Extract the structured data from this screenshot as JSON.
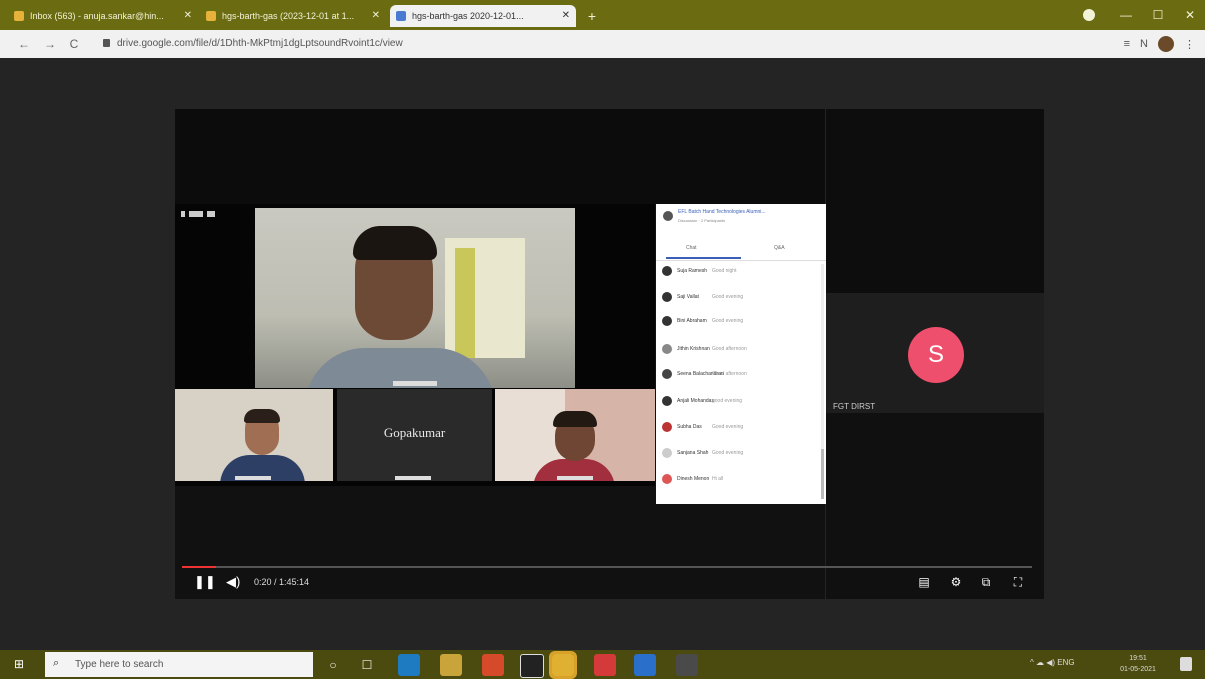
{
  "browser": {
    "tabs": [
      {
        "label": "Inbox (563) - anuja.sankar@hin...",
        "active": false
      },
      {
        "label": "hgs-barth-gas (2023-12-01 at 1...",
        "active": false
      },
      {
        "label": "hgs-barth-gas 2020-12-01...",
        "active": true
      }
    ],
    "new_tab": "+",
    "window_controls": [
      "—",
      "☐",
      "✕"
    ],
    "nav": {
      "back": "←",
      "forward": "→",
      "reload": "C"
    },
    "url": "drive.google.com/file/d/1Dhth-MkPtmj1dgLptsoundRvoint1c/view",
    "toolbar_icons": [
      "≡",
      "N"
    ]
  },
  "player": {
    "time": "0:20 / 1:45:14",
    "play_icon": "❚❚",
    "volume_icon": "◀)",
    "progress": 0.04,
    "controls": [
      "▤",
      "⚙",
      "⧉",
      "⛶"
    ]
  },
  "meeting": {
    "tile_center_name": "Gopakumar",
    "side_initial": "S",
    "side_name": "FGT DIRST",
    "chat": {
      "title": "EFL Batch Hand Technologies Alumni...",
      "subtitle": "Discussion · 2 Participants",
      "tabs": [
        "Chat",
        "Q&A"
      ],
      "messages": [
        {
          "name": "Suja Ramesh",
          "text": "Good night"
        },
        {
          "name": "Saji Vallat",
          "text": "Good evening"
        },
        {
          "name": "Bini Abraham",
          "text": "Good evening"
        },
        {
          "name": "Jithin Krishnan",
          "text": "Good afternoon"
        },
        {
          "name": "Seena Balachandran",
          "text": "Good afternoon"
        },
        {
          "name": "Anjali Mohandas",
          "text": "good evening"
        },
        {
          "name": "Subha Das",
          "text": "Good evening"
        },
        {
          "name": "Sanjana Shah",
          "text": "Good evening"
        },
        {
          "name": "Dinesh Menon",
          "text": "Hi all"
        }
      ]
    }
  },
  "taskbar": {
    "search_placeholder": "Type here to search",
    "search_icon": "⌕",
    "start_icon": "⊞",
    "tray": "^ ☁ ◀) ENG",
    "time": "19:51",
    "date": "01-05-2021",
    "apps": [
      "○",
      "☐",
      "edge",
      "files",
      "chrome",
      "store",
      "acrobat",
      "pdf",
      "mail",
      "settings"
    ],
    "app_colors": [
      "#444",
      "#444",
      "#1f7bc1",
      "#c9a43a",
      "#d44a2a",
      "#222",
      "#e0b032",
      "#d43a3a",
      "#2a6fc9",
      "#4a4a4a"
    ]
  },
  "colors": {
    "titlebar": "#6b6b12",
    "taskbar": "#4b4b0f",
    "avatar_pink": "#ee4f6c",
    "progress_red": "#e33"
  }
}
